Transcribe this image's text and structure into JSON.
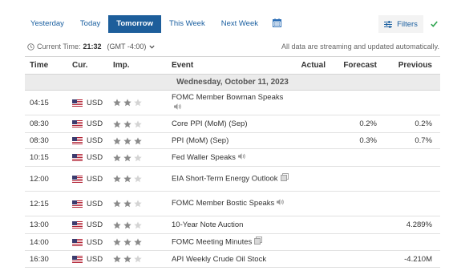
{
  "tabs": [
    {
      "label": "Yesterday",
      "active": false
    },
    {
      "label": "Today",
      "active": false
    },
    {
      "label": "Tomorrow",
      "active": true
    },
    {
      "label": "This Week",
      "active": false
    },
    {
      "label": "Next Week",
      "active": false
    }
  ],
  "toolbar": {
    "filters_label": "Filters",
    "calendar_icon": "calendar-icon",
    "filter_icon": "sliders-icon",
    "check_icon": "check-icon"
  },
  "time_bar": {
    "label": "Current Time:",
    "time": "21:32",
    "timezone": "(GMT -4:00)",
    "streaming_note": "All data are streaming and updated automatically."
  },
  "colors": {
    "accent": "#1d5e9b",
    "star_on": "#8a8a8a",
    "star_off": "#d4d4d4",
    "check": "#2ea44f"
  },
  "table": {
    "columns": {
      "time": "Time",
      "currency": "Cur.",
      "importance": "Imp.",
      "event": "Event",
      "actual": "Actual",
      "forecast": "Forecast",
      "previous": "Previous"
    },
    "day_header": "Wednesday, October 11, 2023",
    "rows": [
      {
        "time": "04:15",
        "currency": "USD",
        "importance": 2,
        "event": "FOMC Member Bowman Speaks",
        "icon": "speaker",
        "actual": "",
        "forecast": "",
        "previous": ""
      },
      {
        "time": "08:30",
        "currency": "USD",
        "importance": 2,
        "event": "Core PPI (MoM) (Sep)",
        "icon": "",
        "actual": "",
        "forecast": "0.2%",
        "previous": "0.2%"
      },
      {
        "time": "08:30",
        "currency": "USD",
        "importance": 3,
        "event": "PPI (MoM) (Sep)",
        "icon": "",
        "actual": "",
        "forecast": "0.3%",
        "previous": "0.7%"
      },
      {
        "time": "10:15",
        "currency": "USD",
        "importance": 2,
        "event": "Fed Waller Speaks",
        "icon": "speaker",
        "actual": "",
        "forecast": "",
        "previous": ""
      },
      {
        "time": "12:00",
        "currency": "USD",
        "importance": 2,
        "event": "EIA Short-Term Energy Outlook",
        "icon": "document",
        "actual": "",
        "forecast": "",
        "previous": ""
      },
      {
        "time": "12:15",
        "currency": "USD",
        "importance": 2,
        "event": "FOMC Member Bostic Speaks",
        "icon": "speaker",
        "actual": "",
        "forecast": "",
        "previous": ""
      },
      {
        "time": "13:00",
        "currency": "USD",
        "importance": 2,
        "event": "10-Year Note Auction",
        "icon": "",
        "actual": "",
        "forecast": "",
        "previous": "4.289%"
      },
      {
        "time": "14:00",
        "currency": "USD",
        "importance": 3,
        "event": "FOMC Meeting Minutes",
        "icon": "document",
        "actual": "",
        "forecast": "",
        "previous": ""
      },
      {
        "time": "16:30",
        "currency": "USD",
        "importance": 2,
        "event": "API Weekly Crude Oil Stock",
        "icon": "",
        "actual": "",
        "forecast": "",
        "previous": "-4.210M"
      }
    ]
  }
}
